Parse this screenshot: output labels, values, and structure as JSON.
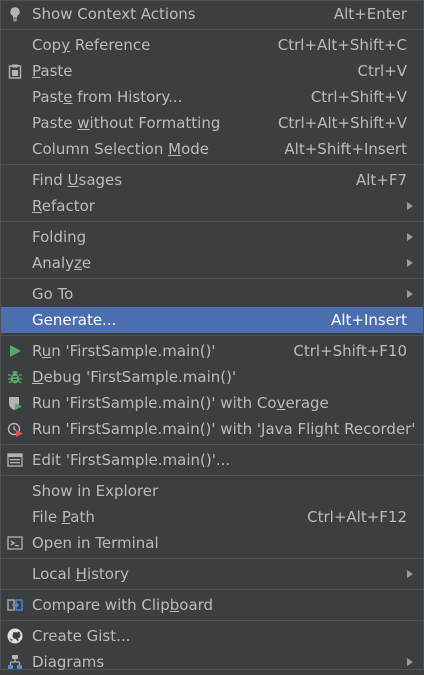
{
  "menu": {
    "items": [
      {
        "label": "Show Context Actions",
        "shortcut": "Alt+Enter"
      },
      {
        "label_pre": "Cop",
        "label_mn": "y",
        "label_post": " Reference",
        "shortcut": "Ctrl+Alt+Shift+C"
      },
      {
        "label_pre": "",
        "label_mn": "P",
        "label_post": "aste",
        "shortcut": "Ctrl+V"
      },
      {
        "label_pre": "Past",
        "label_mn": "e",
        "label_post": " from History...",
        "shortcut": "Ctrl+Shift+V"
      },
      {
        "label_pre": "Paste ",
        "label_mn": "w",
        "label_post": "ithout Formatting",
        "shortcut": "Ctrl+Alt+Shift+V"
      },
      {
        "label_pre": "Column Selection ",
        "label_mn": "M",
        "label_post": "ode",
        "shortcut": "Alt+Shift+Insert"
      },
      {
        "label_pre": "Find ",
        "label_mn": "U",
        "label_post": "sages",
        "shortcut": "Alt+F7"
      },
      {
        "label_pre": "",
        "label_mn": "R",
        "label_post": "efactor"
      },
      {
        "label": "Folding"
      },
      {
        "label_pre": "Analy",
        "label_mn": "z",
        "label_post": "e"
      },
      {
        "label": "Go To"
      },
      {
        "label": "Generate...",
        "shortcut": "Alt+Insert"
      },
      {
        "label_pre": "R",
        "label_mn": "u",
        "label_post": "n 'FirstSample.main()'",
        "shortcut": "Ctrl+Shift+F10"
      },
      {
        "label_pre": "",
        "label_mn": "D",
        "label_post": "ebug 'FirstSample.main()'"
      },
      {
        "label_pre": "Run 'FirstSample.main()' with Co",
        "label_mn": "v",
        "label_post": "erage"
      },
      {
        "label": "Run 'FirstSample.main()' with 'Java Flight Recorder'"
      },
      {
        "label": "Edit 'FirstSample.main()'..."
      },
      {
        "label": "Show in Explorer"
      },
      {
        "label_pre": "File ",
        "label_mn": "P",
        "label_post": "ath",
        "shortcut": "Ctrl+Alt+F12"
      },
      {
        "label": "Open in Terminal"
      },
      {
        "label_pre": "Local ",
        "label_mn": "H",
        "label_post": "istory"
      },
      {
        "label_pre": "Compare with Clip",
        "label_mn": "b",
        "label_post": "oard"
      },
      {
        "label": "Create Gist..."
      },
      {
        "label": "Diagrams"
      }
    ]
  },
  "icons": {
    "context_actions": "lightbulb-icon",
    "paste": "clipboard-icon",
    "run": "run-triangle-icon",
    "debug": "debug-bug-icon",
    "coverage": "coverage-shield-icon",
    "flight_recorder": "stopwatch-run-icon",
    "edit_config": "edit-config-icon",
    "terminal": "terminal-icon",
    "compare_clipboard": "compare-icon",
    "gist": "github-icon",
    "diagrams": "diagram-icon"
  },
  "colors": {
    "background": "#3c3f41",
    "selected": "#4b6eaf",
    "text": "#bbbbbb",
    "separator": "#515151",
    "run_green": "#59a869",
    "record_red": "#d85050"
  }
}
